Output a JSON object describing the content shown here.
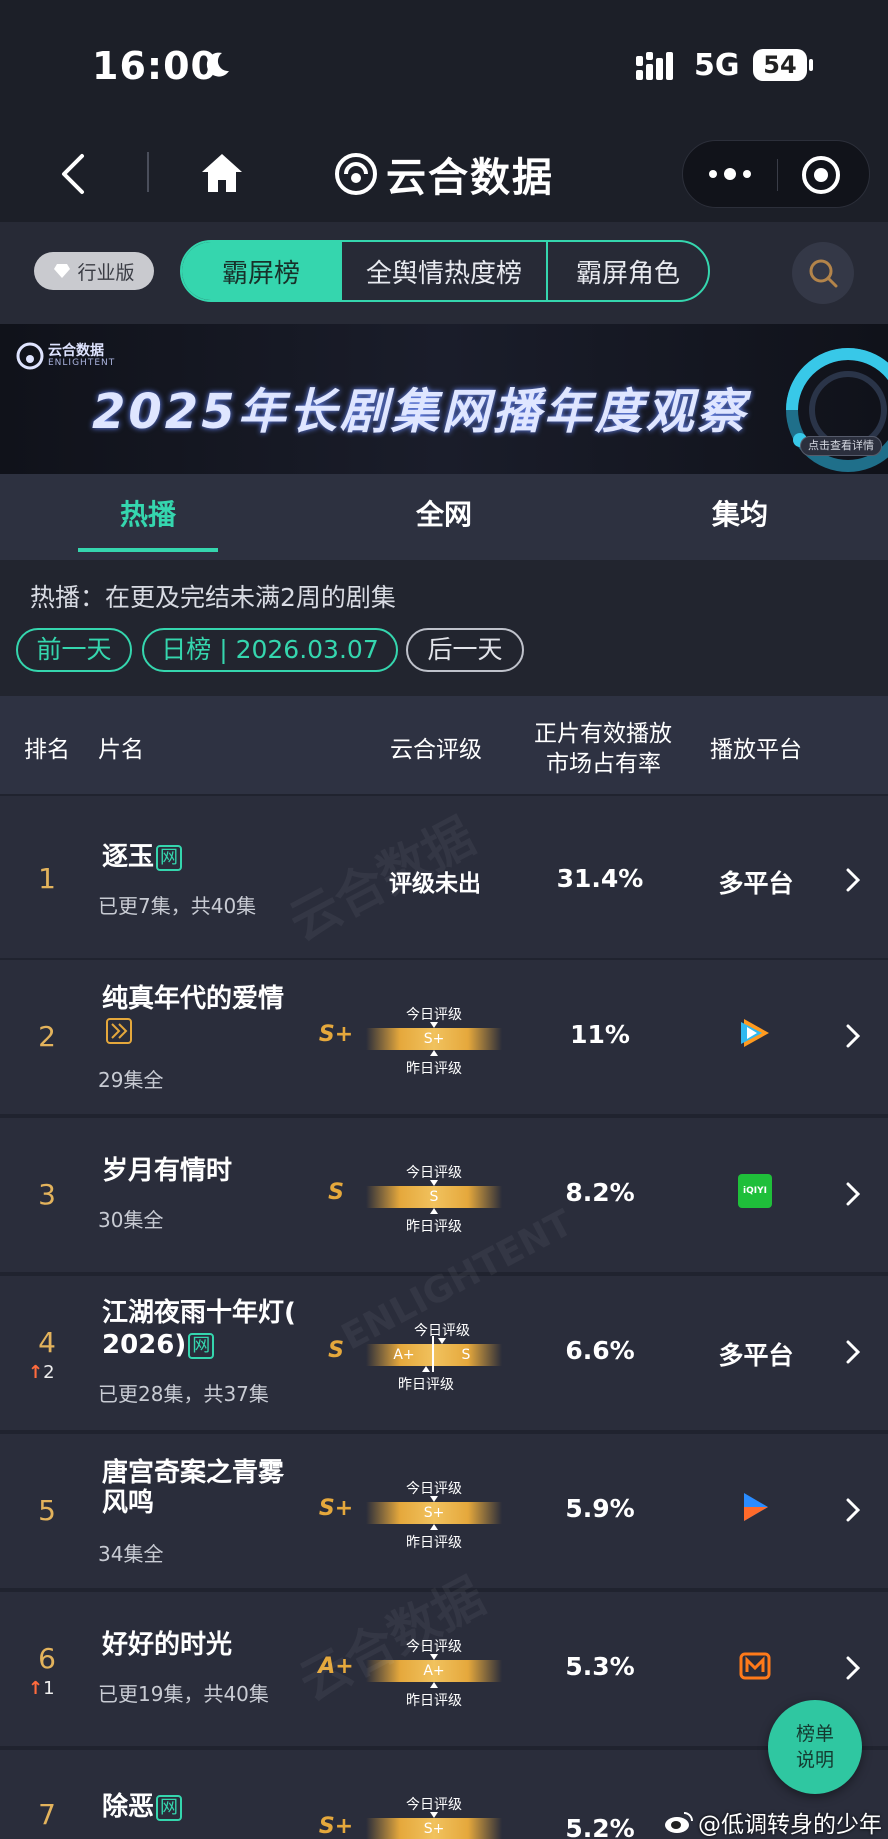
{
  "status_bar": {
    "time": "16:00",
    "network": "5G",
    "battery": "54"
  },
  "nav": {
    "brand": "云合数据"
  },
  "segments": {
    "badge": "行业版",
    "items": [
      "霸屏榜",
      "全舆情热度榜",
      "霸屏角色"
    ]
  },
  "banner": {
    "logo_text": "云合数据",
    "logo_sub": "ENLIGHTENT",
    "title": "2025年长剧集网播年度观察",
    "cta": "点击查看详情"
  },
  "tabs": [
    "热播",
    "全网",
    "集均"
  ],
  "info": {
    "description": "热播：在更及完结未满2周的剧集",
    "prev": "前一天",
    "date": "日榜 | 2026.03.07",
    "next": "后一天"
  },
  "table_header": {
    "rank": "排名",
    "name": "片名",
    "rating": "云合评级",
    "share_line1": "正片有效播放",
    "share_line2": "市场占有率",
    "platform": "播放平台"
  },
  "meter_labels": {
    "today": "今日评级",
    "yesterday": "昨日评级"
  },
  "rows": [
    {
      "rank": "1",
      "title": "逐玉",
      "badge": "网",
      "sub": "已更7集，共40集",
      "rating_text": "评级未出",
      "share": "31.4%",
      "platform_text": "多平台"
    },
    {
      "rank": "2",
      "title_line1": "纯真年代的爱情",
      "sub": "29集全",
      "grade": "S+",
      "meter_value": "S+",
      "share": "11%",
      "platform_icon": "tencent-video-icon"
    },
    {
      "rank": "3",
      "title": "岁月有情时",
      "sub": "30集全",
      "grade": "S",
      "meter_value": "S",
      "share": "8.2%",
      "platform_icon": "iqiyi-icon",
      "platform_icon_text": "iQIYI"
    },
    {
      "rank": "4",
      "rank_change": "2",
      "title_line1": "江湖夜雨十年灯(",
      "title_line2": "2026)",
      "badge": "网",
      "sub": "已更28集，共37集",
      "grade": "S",
      "meter_prev": "A+",
      "meter_value": "S",
      "share": "6.6%",
      "platform_text": "多平台"
    },
    {
      "rank": "5",
      "title_line1": "唐宫奇案之青雾",
      "title_line2": "风鸣",
      "sub": "34集全",
      "grade": "S+",
      "meter_value": "S+",
      "share": "5.9%",
      "platform_icon": "youku-icon"
    },
    {
      "rank": "6",
      "rank_change": "1",
      "title": "好好的时光",
      "sub": "已更19集，共40集",
      "grade": "A+",
      "meter_value": "A+",
      "share": "5.3%",
      "platform_icon": "mango-tv-icon"
    },
    {
      "rank": "7",
      "title": "除恶",
      "badge": "网",
      "grade": "S+",
      "meter_value": "S+",
      "share": "5.2%"
    }
  ],
  "watermark": {
    "text": "云合数据",
    "sub": "ENLIGHTENT"
  },
  "float_button": {
    "line1": "榜单",
    "line2": "说明"
  },
  "weibo_handle": "@低调转身的少年",
  "colors": {
    "accent": "#35d6ae",
    "gold": "#e5a83c",
    "up": "#ff6b3d",
    "background": "#20232f"
  }
}
